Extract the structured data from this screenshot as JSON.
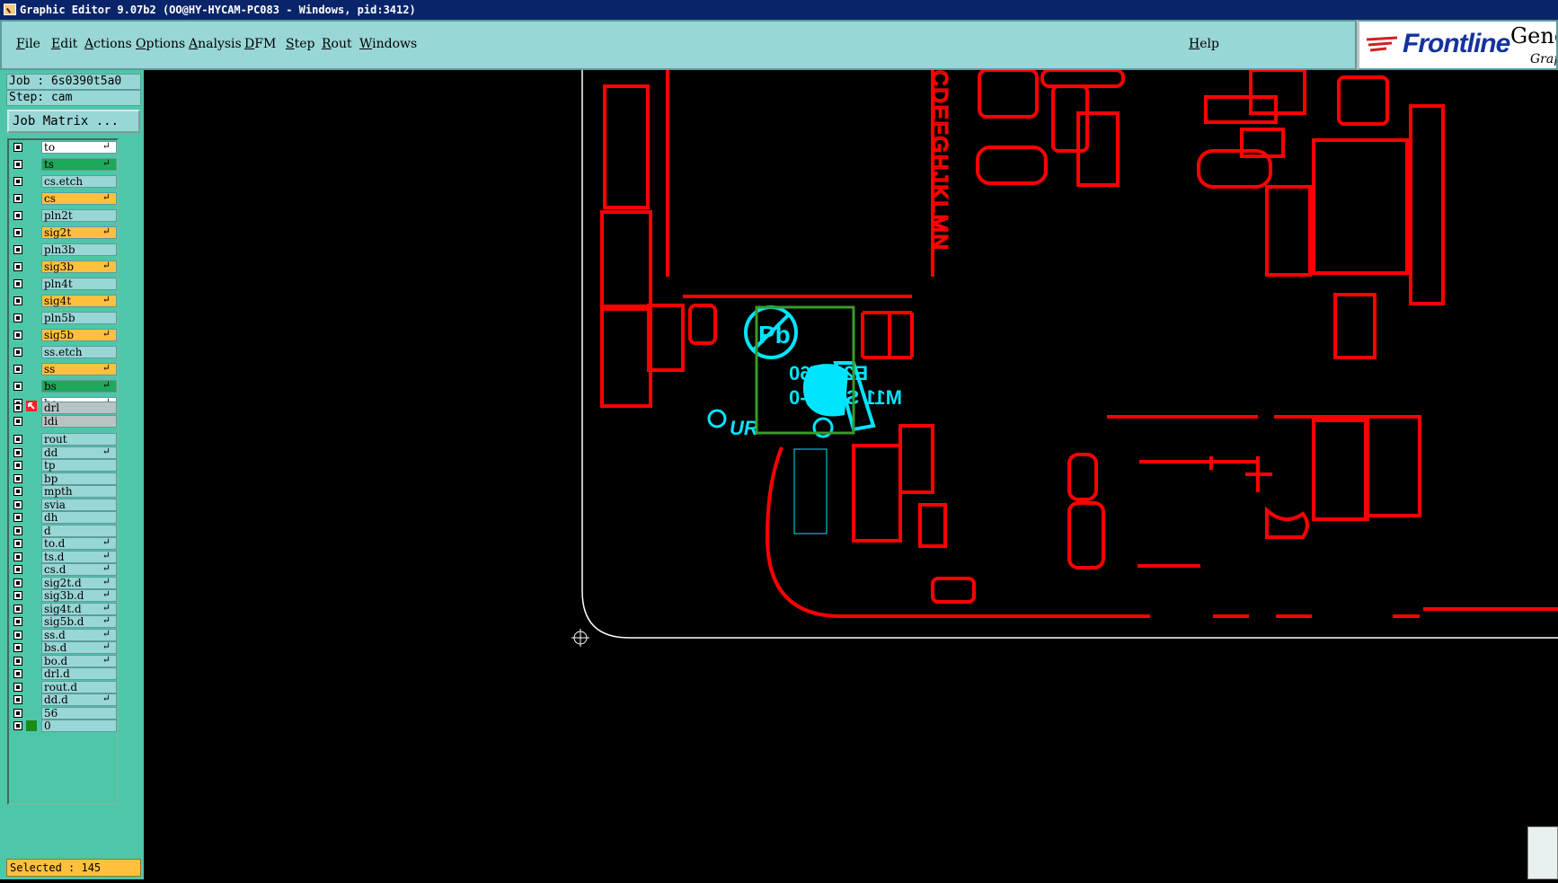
{
  "window": {
    "title": "Graphic Editor 9.07b2 (OO@HY-HYCAM-PC083 - Windows, pid:3412)"
  },
  "menu": {
    "items": [
      "File",
      "Edit",
      "Actions",
      "Options",
      "Analysis",
      "DFM",
      "Step",
      "Rout",
      "Windows"
    ],
    "help": "Help"
  },
  "logo": {
    "brand": "Frontline",
    "product": "Gene",
    "sub": "Grap"
  },
  "job": {
    "job_line": "Job : 6s0390t5a0",
    "step_line": "Step: cam",
    "matrix_button": "Job Matrix ..."
  },
  "layers": [
    {
      "name": "to",
      "style": "white",
      "arrow": true
    },
    {
      "name": "ts",
      "style": "green",
      "arrow": true
    },
    {
      "name": "cs.etch",
      "style": "plain",
      "arrow": false
    },
    {
      "name": "cs",
      "style": "board",
      "arrow": true
    },
    {
      "name": "pln2t",
      "style": "plain",
      "arrow": false
    },
    {
      "name": "sig2t",
      "style": "board",
      "arrow": true
    },
    {
      "name": "pln3b",
      "style": "plain",
      "arrow": false
    },
    {
      "name": "sig3b",
      "style": "board",
      "arrow": true
    },
    {
      "name": "pln4t",
      "style": "plain",
      "arrow": false
    },
    {
      "name": "sig4t",
      "style": "board",
      "arrow": true
    },
    {
      "name": "pln5b",
      "style": "plain",
      "arrow": false
    },
    {
      "name": "sig5b",
      "style": "board",
      "arrow": true
    },
    {
      "name": "ss.etch",
      "style": "plain",
      "arrow": false
    },
    {
      "name": "ss",
      "style": "board",
      "arrow": true
    },
    {
      "name": "bs",
      "style": "green",
      "arrow": true
    },
    {
      "name": "bo",
      "style": "white",
      "arrow": true,
      "work": true
    },
    {
      "name": "drl",
      "style": "gray",
      "arrow": false
    },
    {
      "name": "ldi",
      "style": "gray",
      "arrow": false
    },
    {
      "name": "rout",
      "style": "plain",
      "arrow": false
    },
    {
      "name": "dd",
      "style": "plain",
      "arrow": true
    },
    {
      "name": "tp",
      "style": "plain",
      "arrow": false
    },
    {
      "name": "bp",
      "style": "plain",
      "arrow": false
    },
    {
      "name": "mpth",
      "style": "plain",
      "arrow": false
    },
    {
      "name": "svia",
      "style": "plain",
      "arrow": false
    },
    {
      "name": "dh",
      "style": "plain",
      "arrow": false
    },
    {
      "name": "d",
      "style": "plain",
      "arrow": false
    },
    {
      "name": "to.d",
      "style": "plain",
      "arrow": true
    },
    {
      "name": "ts.d",
      "style": "plain",
      "arrow": true
    },
    {
      "name": "cs.d",
      "style": "plain",
      "arrow": true
    },
    {
      "name": "sig2t.d",
      "style": "plain",
      "arrow": true
    },
    {
      "name": "sig3b.d",
      "style": "plain",
      "arrow": true
    },
    {
      "name": "sig4t.d",
      "style": "plain",
      "arrow": true
    },
    {
      "name": "sig5b.d",
      "style": "plain",
      "arrow": true
    },
    {
      "name": "ss.d",
      "style": "plain",
      "arrow": true
    },
    {
      "name": "bs.d",
      "style": "plain",
      "arrow": true
    },
    {
      "name": "bo.d",
      "style": "plain",
      "arrow": true
    },
    {
      "name": "drl.d",
      "style": "plain",
      "arrow": false
    },
    {
      "name": "rout.d",
      "style": "plain",
      "arrow": false
    },
    {
      "name": "dd.d",
      "style": "plain",
      "arrow": true
    },
    {
      "name": "56",
      "style": "plain",
      "arrow": false
    },
    {
      "name": "0",
      "style": "plain",
      "arrow": false
    }
  ],
  "status": {
    "selected": "Selected : 145"
  },
  "canvas": {
    "silk_text_1": "E204460",
    "silk_text_2": "M11 S 94V-0",
    "silk_text_3": "UR",
    "silk_text_4": "Pb",
    "vertical_text": "CDEFGHJKLMN",
    "colors": {
      "background": "#000000",
      "copper": "#ff0000",
      "silk": "#00e5ff",
      "outline": "#ffffff",
      "selection": "#3a9a2a"
    }
  }
}
